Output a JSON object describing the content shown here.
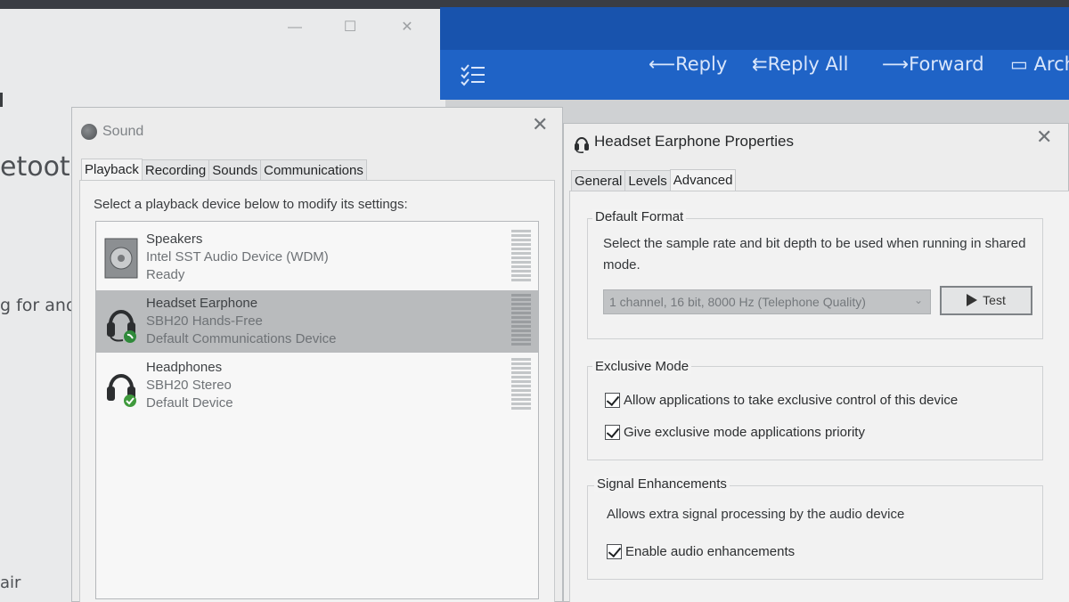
{
  "mail": {
    "commands": {
      "reply": "Reply",
      "reply_all": "Reply All",
      "forward": "Forward",
      "archive": "Arch"
    }
  },
  "background_window": {
    "fragments": [
      "etooth",
      "g for and",
      "air"
    ]
  },
  "sound_dialog": {
    "title": "Sound",
    "tabs": [
      "Playback",
      "Recording",
      "Sounds",
      "Communications"
    ],
    "active_tab": "Playback",
    "prompt": "Select a playback device below to modify its settings:",
    "devices": [
      {
        "name": "Speakers",
        "driver": "Intel SST Audio Device (WDM)",
        "status": "Ready",
        "icon": "speaker-icon",
        "selected": false
      },
      {
        "name": "Headset Earphone",
        "driver": "SBH20 Hands-Free",
        "status": "Default Communications Device",
        "icon": "headset-phone-icon",
        "selected": true
      },
      {
        "name": "Headphones",
        "driver": "SBH20 Stereo",
        "status": "Default Device",
        "icon": "headphones-check-icon",
        "selected": false
      }
    ]
  },
  "properties_dialog": {
    "title": "Headset Earphone Properties",
    "tabs": [
      "General",
      "Levels",
      "Advanced"
    ],
    "active_tab": "Advanced",
    "default_format": {
      "label": "Default Format",
      "description_line1": "Select the sample rate and bit depth to be used when running in shared",
      "description_line2": "mode.",
      "selected_format": "1 channel, 16 bit, 8000 Hz (Telephone Quality)",
      "test_label": "Test"
    },
    "exclusive_mode": {
      "label": "Exclusive Mode",
      "allow_label": "Allow applications to take exclusive control of this device",
      "allow_checked": true,
      "priority_label": "Give exclusive mode applications priority",
      "priority_checked": true
    },
    "signal_enhancements": {
      "label": "Signal Enhancements",
      "description": "Allows extra signal processing by the audio device",
      "enable_label": "Enable audio enhancements",
      "enable_checked": true
    }
  }
}
